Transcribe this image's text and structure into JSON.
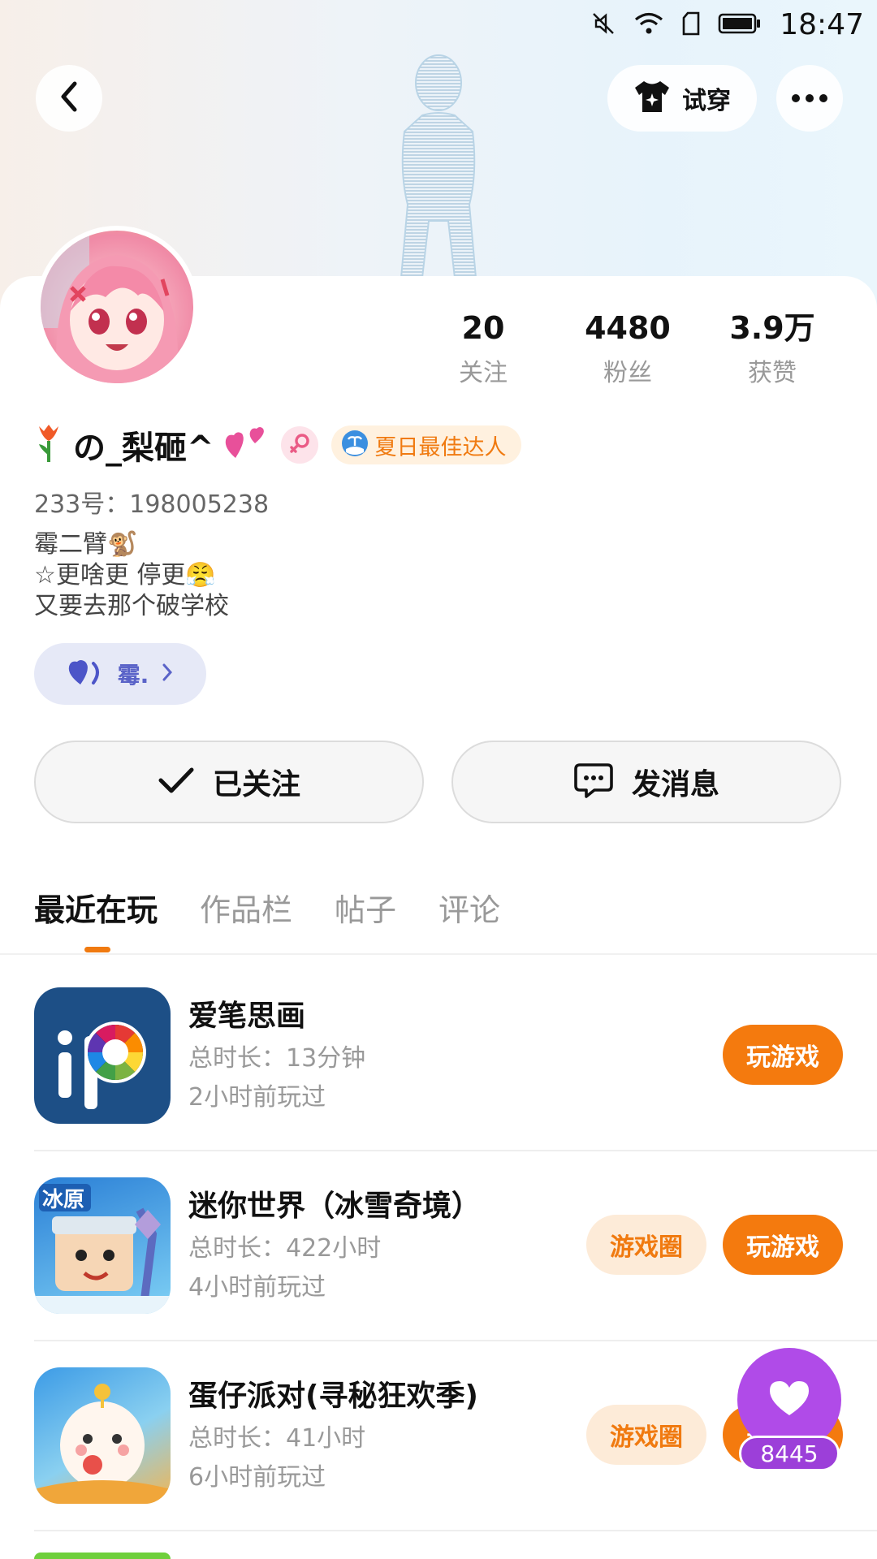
{
  "status_bar": {
    "time": "18:47"
  },
  "header": {
    "tryon_label": "试穿"
  },
  "profile": {
    "stats": [
      {
        "value": "20",
        "label": "关注"
      },
      {
        "value": "4480",
        "label": "粉丝"
      },
      {
        "value": "3.9万",
        "label": "获赞"
      }
    ],
    "username": "の_梨砸^",
    "title_badge": "夏日最佳达人",
    "uid": "233号：198005238",
    "bio": [
      "霉二臂🐒",
      "☆更啥更 停更😤",
      "又要去那个破学校"
    ],
    "fan_tag": "霉."
  },
  "actions": {
    "follow_label": "已关注",
    "message_label": "发消息"
  },
  "tabs": [
    "最近在玩",
    "作品栏",
    "帖子",
    "评论"
  ],
  "games": [
    {
      "name": "爱笔思画",
      "time": "总时长：13分钟",
      "last": "2小时前玩过",
      "circle_label": "",
      "play_label": "玩游戏"
    },
    {
      "name": "迷你世界（冰雪奇境）",
      "time": "总时长：422小时",
      "last": "4小时前玩过",
      "circle_label": "游戏圈",
      "play_label": "玩游戏"
    },
    {
      "name": "蛋仔派对(寻秘狂欢季)",
      "time": "总时长：41小时",
      "last": "6小时前玩过",
      "circle_label": "游戏圈",
      "play_label": "玩游戏"
    }
  ],
  "game2_icon_text": "冰原",
  "like_widget": {
    "count": "8445"
  },
  "colors": {
    "accent": "#f47a0e",
    "like": "#b04be8",
    "fan_tag": "#5a63c8"
  }
}
